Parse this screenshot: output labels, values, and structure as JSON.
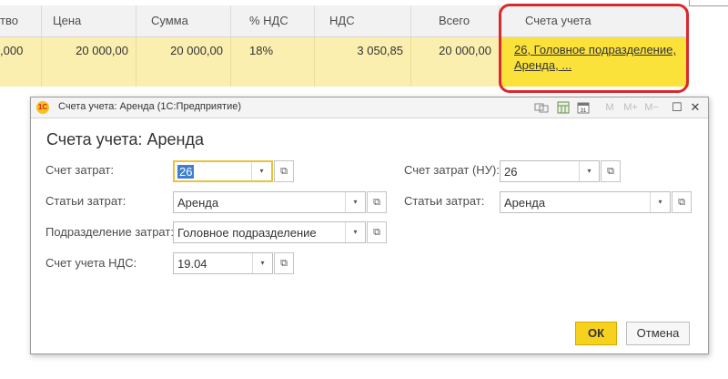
{
  "table": {
    "headers": [
      "тво",
      "Цена",
      "Сумма",
      "% НДС",
      "НДС",
      "Всего",
      "Счета учета"
    ],
    "row": {
      "qty": ",000",
      "price": "20 000,00",
      "sum": "20 000,00",
      "vat_rate": "18%",
      "vat": "3 050,85",
      "total": "20 000,00",
      "accounts": "26, Головное подразделение, Аренда, ..."
    },
    "highlight_color": "#d9292f",
    "row_color": "#fbefb0",
    "selected_cell_color": "#fbe23a"
  },
  "dialog": {
    "window_title": "Счета учета: Аренда  (1С:Предприятие)",
    "logo_text": "1С",
    "toolbar": {
      "m": "M",
      "m_plus": "M+",
      "m_minus": "M−",
      "restore": "☐",
      "close": "✕"
    },
    "form_title": "Счета учета: Аренда",
    "left": {
      "cost_account_label": "Счет затрат:",
      "cost_account_value": "26",
      "cost_items_label": "Статьи затрат:",
      "cost_items_value": "Аренда",
      "division_label": "Подразделение затрат:",
      "division_value": "Головное подразделение",
      "vat_account_label": "Счет учета НДС:",
      "vat_account_value": "19.04"
    },
    "right": {
      "cost_account_nu_label": "Счет затрат (НУ):",
      "cost_account_nu_value": "26",
      "cost_items_label": "Статьи затрат:",
      "cost_items_value": "Аренда"
    },
    "buttons": {
      "ok": "ОК",
      "cancel": "Отмена"
    },
    "accent_color": "#f6d21f"
  }
}
